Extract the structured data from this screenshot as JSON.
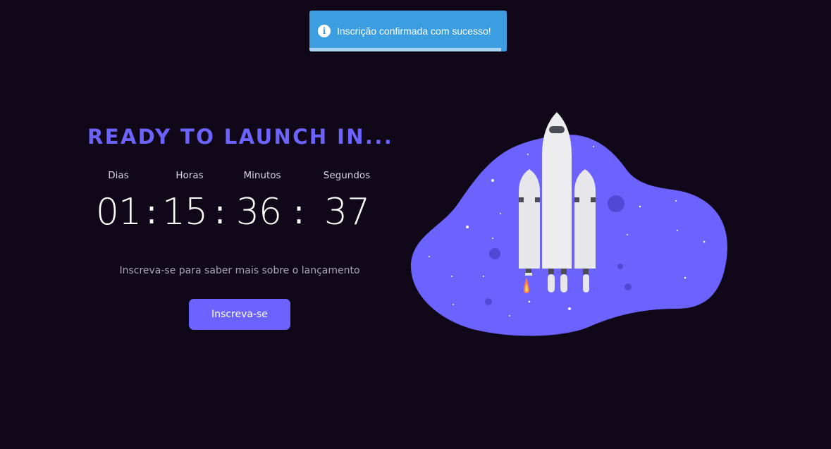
{
  "toast": {
    "icon": "info-icon",
    "message": "Inscrição confirmada com sucesso!",
    "progress": 0.97,
    "color": "#3a9ee0"
  },
  "heading": "READY TO LAUNCH IN...",
  "countdown": {
    "units": [
      {
        "label": "Dias",
        "value": "01"
      },
      {
        "label": "Horas",
        "value": "15"
      },
      {
        "label": "Minutos",
        "value": "36"
      },
      {
        "label": "Segundos",
        "value": "37"
      }
    ],
    "separator": ":"
  },
  "subtitle": "Inscreva-se para saber mais sobre o lançamento",
  "cta_label": "Inscreva-se",
  "illustration": {
    "icon": "rocket-illustration",
    "blob_color": "#6c63ff"
  },
  "colors": {
    "background": "#100818",
    "accent": "#6c63ff"
  }
}
